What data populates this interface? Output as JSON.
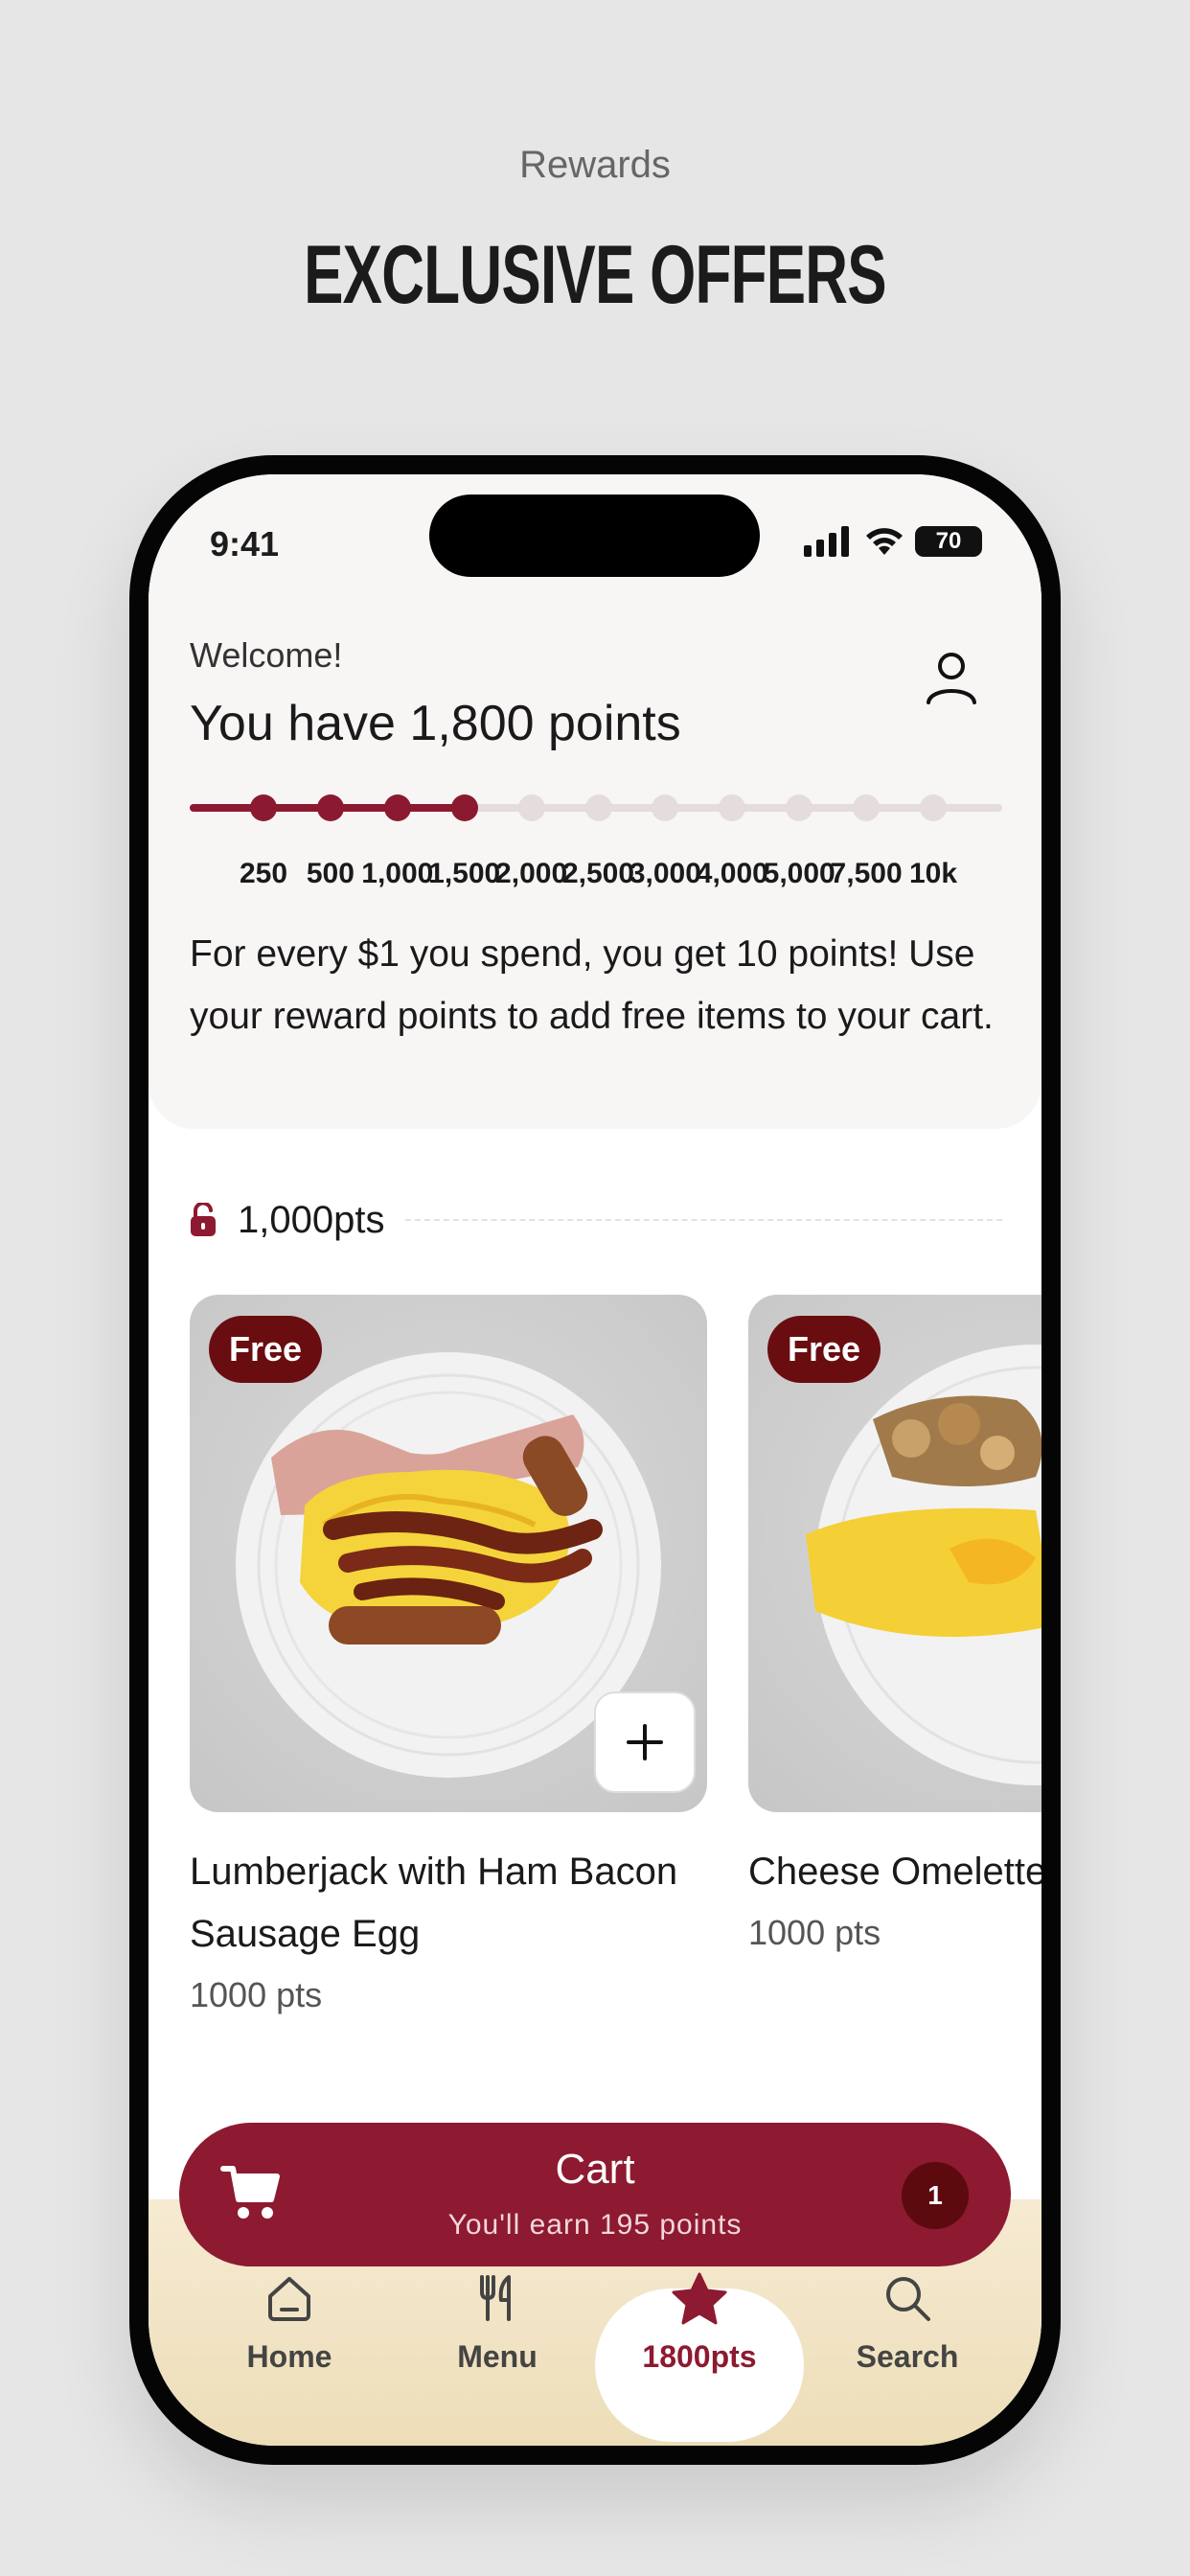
{
  "page": {
    "subtitle": "Rewards",
    "title": "EXCLUSIVE OFFERS"
  },
  "status": {
    "time": "9:41",
    "battery": "70"
  },
  "header": {
    "welcome": "Welcome!",
    "points_text": "You have 1,800 points"
  },
  "progress": {
    "current_points": 1800,
    "ticks": [
      "250",
      "500",
      "1,000",
      "1,500",
      "2,000",
      "2,500",
      "3,000",
      "4,000",
      "5,000",
      "7,500",
      "10k"
    ],
    "reached_ticks": 4
  },
  "info": "For every $1 you spend, you get 10 points! Use your reward points to add free items to your cart.",
  "tier": {
    "label": "1,000pts"
  },
  "items": [
    {
      "badge": "Free",
      "name": "Lumberjack with Ham Bacon Sausage Egg",
      "points": "1000 pts",
      "image_icon": "breakfast-plate-image"
    },
    {
      "badge": "Free",
      "name": "Cheese Omelette",
      "points": "1000 pts",
      "image_icon": "omelette-plate-image"
    }
  ],
  "cart": {
    "title": "Cart",
    "subtitle": "You'll earn 195 points",
    "count": "1"
  },
  "nav": [
    {
      "label": "Home",
      "icon": "home-icon"
    },
    {
      "label": "Menu",
      "icon": "utensils-icon"
    },
    {
      "label": "1800pts",
      "icon": "star-icon"
    },
    {
      "label": "Search",
      "icon": "search-icon"
    }
  ],
  "colors": {
    "accent": "#8d1a30",
    "badge": "#6a0d10"
  }
}
